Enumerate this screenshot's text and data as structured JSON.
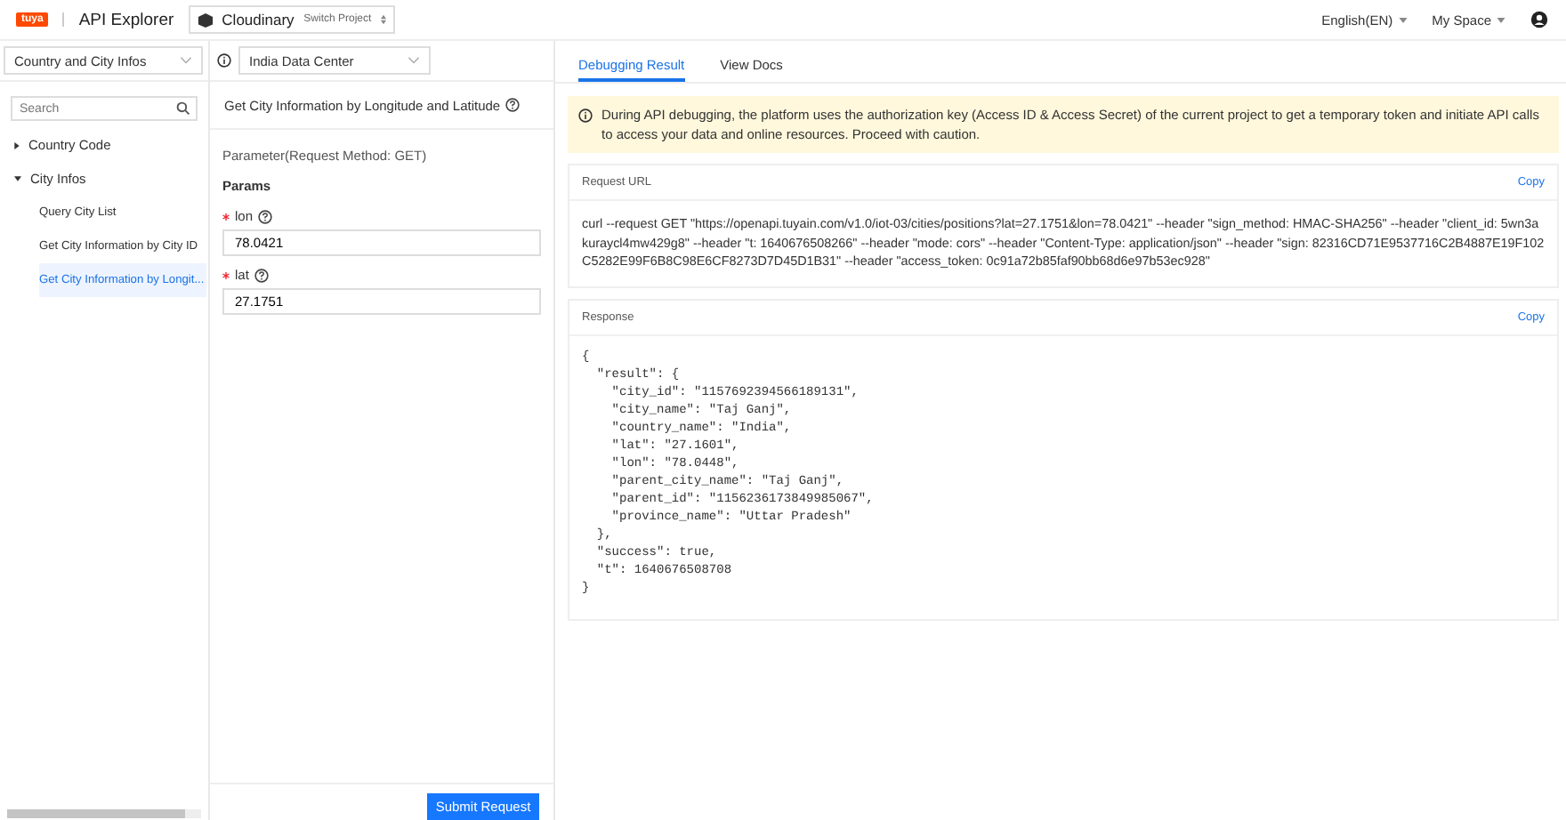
{
  "header": {
    "logo": "tuya",
    "title": "API Explorer",
    "project": "Cloudinary",
    "switch_label": "Switch Project",
    "language": "English(EN)",
    "space": "My Space"
  },
  "category_select": {
    "value": "Country and City Infos"
  },
  "datacenter_select": {
    "value": "India Data Center"
  },
  "search": {
    "placeholder": "Search"
  },
  "tree": [
    {
      "label": "Country Code",
      "expanded": false,
      "selected": false
    },
    {
      "label": "City Infos",
      "expanded": true,
      "selected": false,
      "children": [
        {
          "label": "Query City List",
          "selected": false
        },
        {
          "label": "Get City Information by City ID",
          "selected": false
        },
        {
          "label": "Get City Information by Longit...",
          "selected": true
        }
      ]
    }
  ],
  "api": {
    "title": "Get City Information by Longitude and Latitude",
    "method_label": "Parameter(Request Method: GET)",
    "params_heading": "Params",
    "params": [
      {
        "name": "lon",
        "required": true,
        "value": "78.0421"
      },
      {
        "name": "lat",
        "required": true,
        "value": "27.1751"
      }
    ],
    "submit": "Submit Request"
  },
  "tabs": [
    {
      "label": "Debugging Result",
      "selected": true
    },
    {
      "label": "View Docs",
      "selected": false
    }
  ],
  "notice": "During API debugging, the platform uses the authorization key (Access ID & Access Secret) of the current project to get a temporary token and initiate API calls to access your data and online resources. Proceed with caution.",
  "request": {
    "title": "Request URL",
    "copy": "Copy",
    "text": "curl --request GET \"https://openapi.tuyain.com/v1.0/iot-03/cities/positions?lat=27.1751&lon=78.0421\" --header \"sign_method: HMAC-SHA256\" --header \"client_id: 5wn3akuraycl4mw429g8\" --header \"t: 1640676508266\" --header \"mode: cors\" --header \"Content-Type: application/json\" --header \"sign: 82316CD71E9537716C2B4887E19F102C5282E99F6B8C98E6CF8273D7D45D1B31\" --header \"access_token: 0c91a72b85faf90bb68d6e97b53ec928\""
  },
  "response": {
    "title": "Response",
    "copy": "Copy",
    "text": "{\n  \"result\": {\n    \"city_id\": \"1157692394566189131\",\n    \"city_name\": \"Taj Ganj\",\n    \"country_name\": \"India\",\n    \"lat\": \"27.1601\",\n    \"lon\": \"78.0448\",\n    \"parent_city_name\": \"Taj Ganj\",\n    \"parent_id\": \"1156236173849985067\",\n    \"province_name\": \"Uttar Pradesh\"\n  },\n  \"success\": true,\n  \"t\": 1640676508708\n}"
  }
}
